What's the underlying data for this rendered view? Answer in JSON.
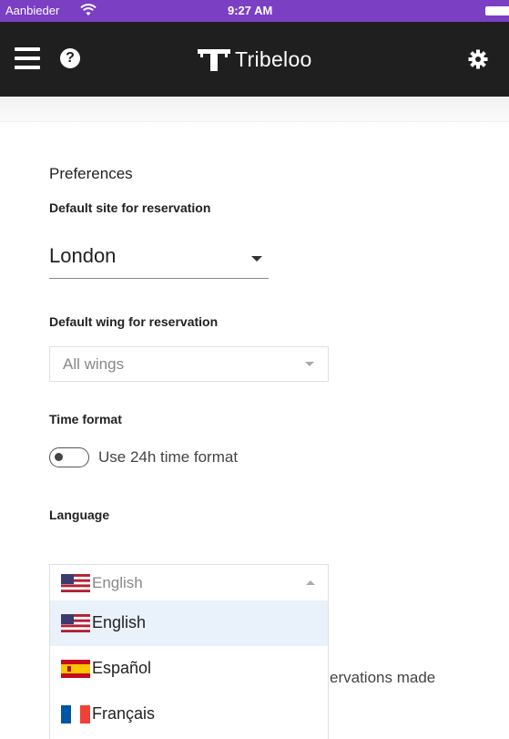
{
  "status_bar": {
    "carrier": "Aanbieder",
    "time": "9:27 AM"
  },
  "app_bar": {
    "brand_name": "Tribeloo",
    "help_glyph": "?"
  },
  "preferences": {
    "title": "Preferences",
    "default_site": {
      "label": "Default site for reservation",
      "value": "London"
    },
    "default_wing": {
      "label": "Default wing for reservation",
      "value": "All wings"
    },
    "time_format": {
      "label": "Time format",
      "toggle_label": "Use 24h time format",
      "enabled": false
    },
    "language": {
      "label": "Language",
      "selected": "English",
      "options": [
        "English",
        "Español",
        "Français"
      ]
    },
    "partially_hidden_text": "ervations made"
  },
  "colors": {
    "status_bar": "#7b3fc4",
    "app_bar": "#1f1f1f",
    "highlight": "#e9f1fb"
  },
  "icons": [
    "wifi-icon",
    "battery-icon",
    "menu-icon",
    "help-icon",
    "tribeloo-logo",
    "gear-icon",
    "chevron-down-icon",
    "chevron-up-icon",
    "flag-us-icon",
    "flag-es-icon",
    "flag-fr-icon"
  ]
}
